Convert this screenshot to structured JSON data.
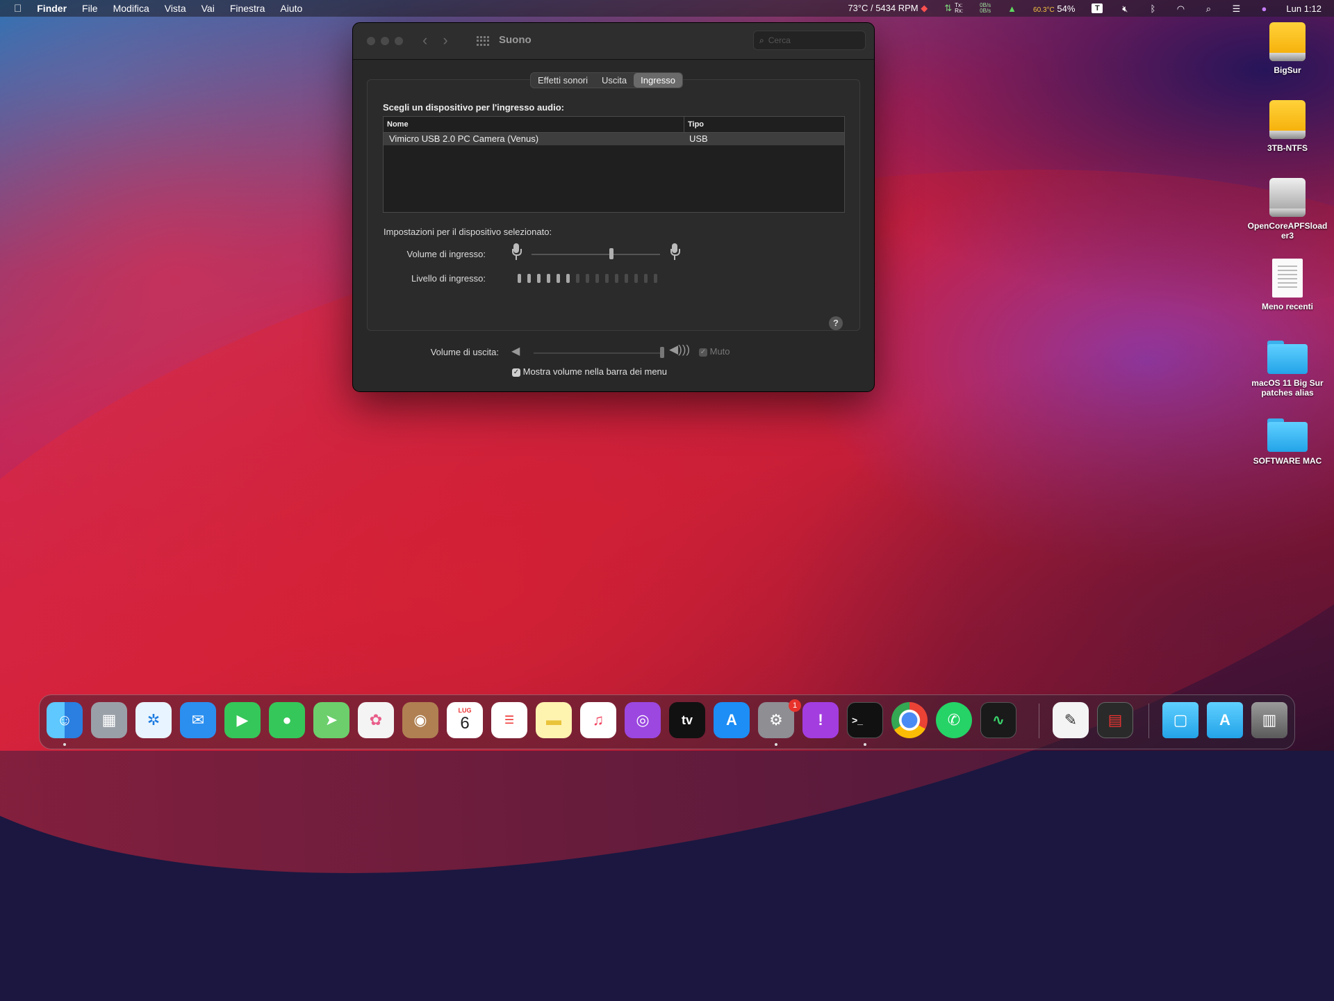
{
  "menubar": {
    "apple": "",
    "app": "Finder",
    "items": [
      "File",
      "Modifica",
      "Vista",
      "Vai",
      "Finestra",
      "Aiuto"
    ],
    "temp_rpm": "73°C / 5434 RPM",
    "net_tx": "Tx:",
    "net_rx": "Rx:",
    "net_tx_val": "0B/s",
    "net_rx_val": "0B/s",
    "cpu_temp": "60.3°C",
    "battery": "54%",
    "clock": "Lun 1:12"
  },
  "window": {
    "title": "Suono",
    "search_placeholder": "Cerca",
    "tabs": [
      "Effetti sonori",
      "Uscita",
      "Ingresso"
    ],
    "active_tab": "Ingresso",
    "section_title": "Scegli un dispositivo per l'ingresso audio:",
    "table": {
      "headers": [
        "Nome",
        "Tipo"
      ],
      "rows": [
        [
          "Vimicro USB 2.0 PC Camera (Venus)",
          "USB"
        ]
      ]
    },
    "selected_settings_title": "Impostazioni per il dispositivo selezionato:",
    "input_volume_label": "Volume di ingresso:",
    "input_volume_fraction": 0.62,
    "input_level_label": "Livello di ingresso:",
    "input_level_lit": 6,
    "input_level_total": 15,
    "help": "?",
    "output_volume_label": "Volume di uscita:",
    "output_volume_fraction": 1.0,
    "mute_label": "Muto",
    "show_volume_label": "Mostra volume nella barra dei menu"
  },
  "desktop": {
    "icons": [
      {
        "label": "BigSur",
        "kind": "drive-yellow"
      },
      {
        "label": "3TB-NTFS",
        "kind": "drive-yellow"
      },
      {
        "label": "OpenCoreAPFSloader3",
        "kind": "drive-gray"
      },
      {
        "label": "Meno recenti",
        "kind": "document"
      },
      {
        "label": "macOS 11 Big Sur patches alias",
        "kind": "folder"
      },
      {
        "label": "SOFTWARE MAC",
        "kind": "folder"
      }
    ]
  },
  "dock": {
    "calendar_month": "LUG",
    "calendar_day": "6",
    "settings_badge": "1",
    "tv_label": "tv"
  }
}
